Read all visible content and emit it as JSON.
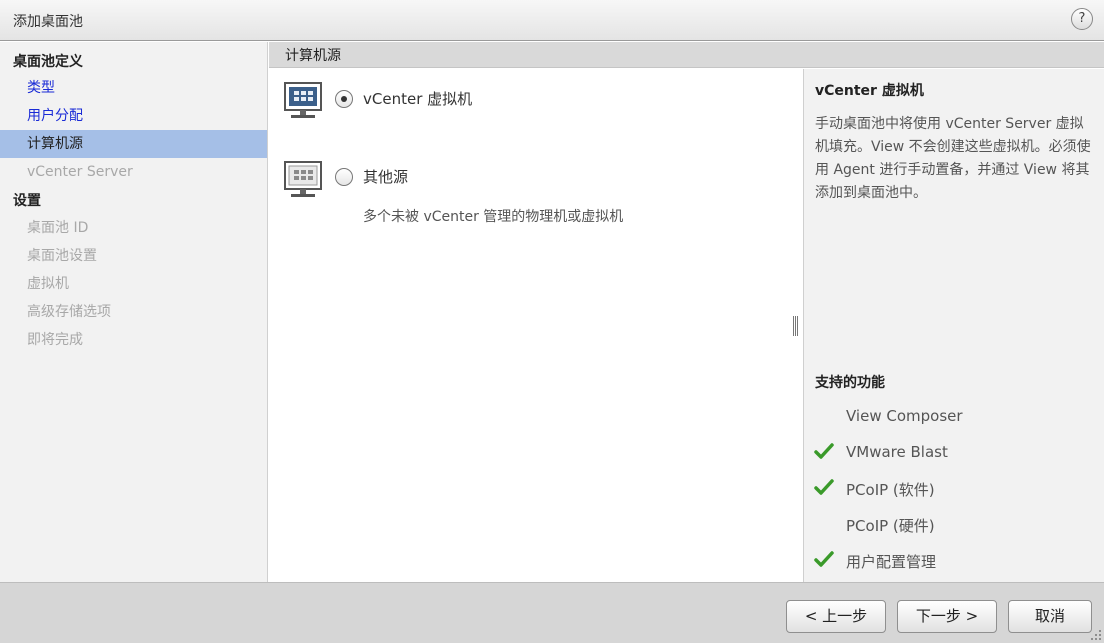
{
  "window": {
    "title": "添加桌面池",
    "help_label": "?"
  },
  "nav": {
    "section_definition": "桌面池定义",
    "definition_items": [
      {
        "label": "类型",
        "state": "link"
      },
      {
        "label": "用户分配",
        "state": "link"
      },
      {
        "label": "计算机源",
        "state": "active"
      },
      {
        "label": "vCenter Server",
        "state": "disabled"
      }
    ],
    "section_settings": "设置",
    "settings_items": [
      {
        "label": "桌面池 ID",
        "state": "disabled"
      },
      {
        "label": "桌面池设置",
        "state": "disabled"
      },
      {
        "label": "虚拟机",
        "state": "disabled"
      },
      {
        "label": "高级存储选项",
        "state": "disabled"
      },
      {
        "label": "即将完成",
        "state": "disabled"
      }
    ]
  },
  "main": {
    "header": "计算机源",
    "options": [
      {
        "label": "vCenter 虚拟机",
        "selected": true,
        "description": "",
        "icon": "monitor-icon"
      },
      {
        "label": "其他源",
        "selected": false,
        "description": "多个未被 vCenter 管理的物理机或虚拟机",
        "icon": "monitor-icon"
      }
    ]
  },
  "info": {
    "title": "vCenter 虚拟机",
    "description": "手动桌面池中将使用 vCenter Server 虚拟机填充。View 不会创建这些虚拟机。必须使用 Agent 进行手动置备，并通过 View 将其添加到桌面池中。",
    "features_title": "支持的功能",
    "features": [
      {
        "label": "View Composer",
        "supported": false
      },
      {
        "label": "VMware Blast",
        "supported": true
      },
      {
        "label": "PCoIP (软件)",
        "supported": true
      },
      {
        "label": "PCoIP (硬件)",
        "supported": false
      },
      {
        "label": "用户配置管理",
        "supported": true
      }
    ],
    "check_color": "#3a9a2a"
  },
  "footer": {
    "back_label": "< 上一步",
    "next_label": "下一步 >",
    "cancel_label": "取消"
  }
}
